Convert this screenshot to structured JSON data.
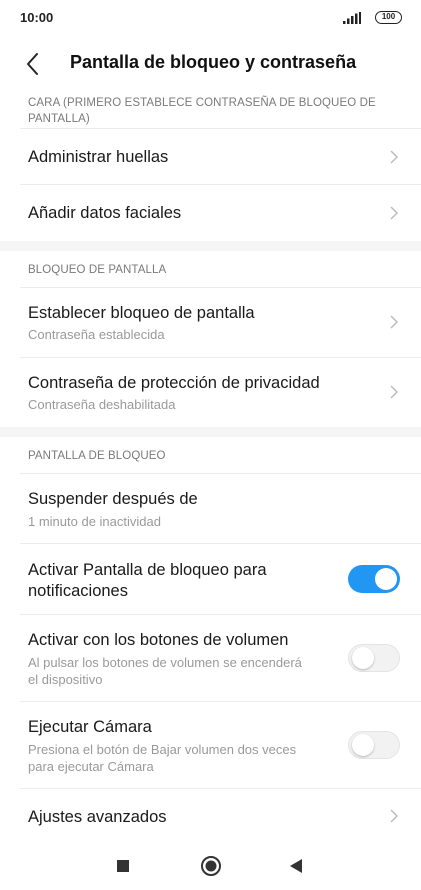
{
  "status": {
    "time": "10:00",
    "battery": "100"
  },
  "header": {
    "title": "Pantalla de bloqueo y contraseña"
  },
  "sections": {
    "face": {
      "header_line1": "CARA (PRIMERO ESTABLECE CONTRASEÑA DE BLOQUEO DE",
      "header_line2": "PANTALLA)",
      "items": [
        {
          "title": "Administrar huellas"
        },
        {
          "title": "Añadir datos faciales"
        }
      ]
    },
    "screen_lock": {
      "header": "BLOQUEO DE PANTALLA",
      "items": [
        {
          "title": "Establecer bloqueo de pantalla",
          "subtitle": "Contraseña establecida"
        },
        {
          "title": "Contraseña de protección de privacidad",
          "subtitle": "Contraseña deshabilitada"
        }
      ]
    },
    "lock_screen": {
      "header": "PANTALLA DE BLOQUEO",
      "items": [
        {
          "title": "Suspender después de",
          "subtitle": "1 minuto de inactividad"
        },
        {
          "title_line1": "Activar Pantalla de bloqueo para",
          "title_line2": "notificaciones",
          "toggle": true
        },
        {
          "title": "Activar con los botones de volumen",
          "subtitle_line1": "Al pulsar los botones de volumen se encenderá",
          "subtitle_line2": "el dispositivo",
          "toggle": false
        },
        {
          "title": "Ejecutar Cámara",
          "subtitle_line1": "Presiona el botón de Bajar volumen dos veces",
          "subtitle_line2": "para ejecutar Cámara",
          "toggle": false
        },
        {
          "title": "Ajustes avanzados"
        }
      ]
    }
  },
  "nav": {
    "icons": [
      "recents-square-icon",
      "home-circle-icon",
      "back-triangle-icon"
    ]
  },
  "colors": {
    "accent": "#2196f3",
    "toggle_off": "#f2f2f2",
    "section_gap": "#f5f5f5"
  }
}
